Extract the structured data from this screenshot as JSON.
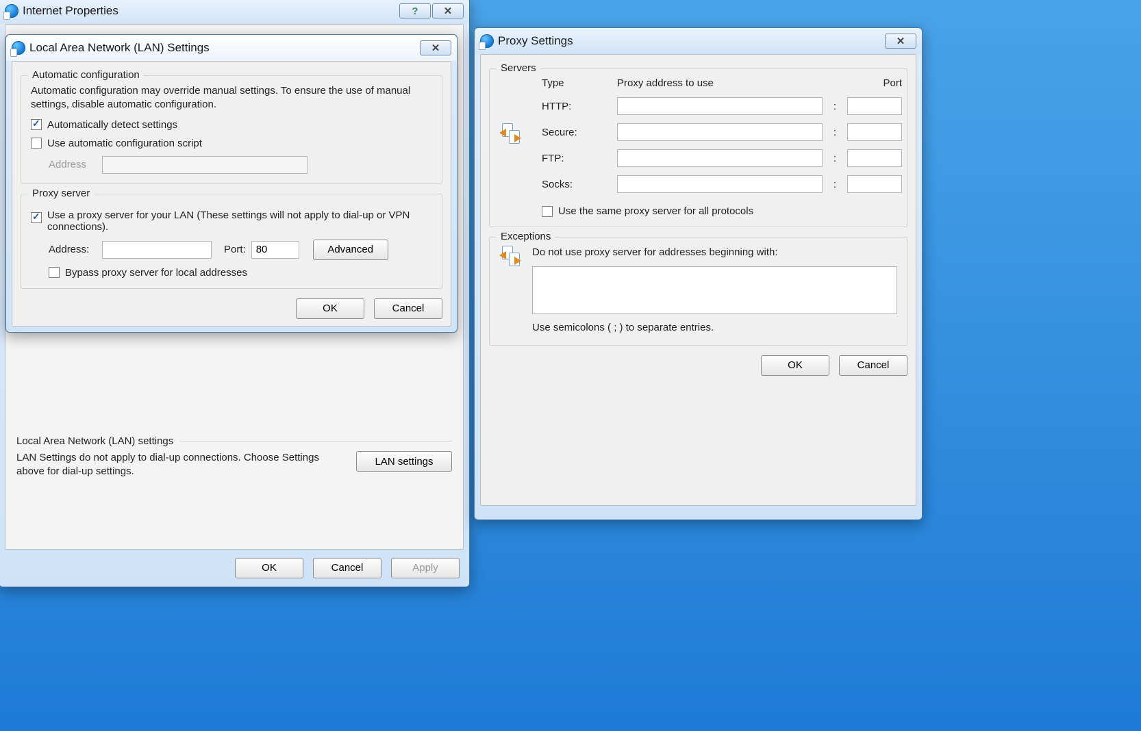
{
  "internet_properties": {
    "title": "Internet Properties",
    "lan_section": {
      "legend": "Local Area Network (LAN) settings",
      "note": "LAN Settings do not apply to dial-up connections.  Choose Settings above for dial-up settings.",
      "lan_button": "LAN settings"
    },
    "buttons": {
      "ok": "OK",
      "cancel": "Cancel",
      "apply": "Apply"
    }
  },
  "lan_settings": {
    "title": "Local Area Network (LAN) Settings",
    "auto": {
      "legend": "Automatic configuration",
      "note": "Automatic configuration may override manual settings.  To ensure the use of manual settings, disable automatic configuration.",
      "auto_detect": "Automatically detect settings",
      "use_script": "Use automatic configuration script",
      "address_label": "Address",
      "address_value": ""
    },
    "proxy": {
      "legend": "Proxy server",
      "use_proxy": "Use a proxy server for your LAN (These settings will not apply to dial-up or VPN connections).",
      "address_label": "Address:",
      "address_value": "",
      "port_label": "Port:",
      "port_value": "80",
      "advanced": "Advanced",
      "bypass_local": "Bypass proxy server for local addresses"
    },
    "buttons": {
      "ok": "OK",
      "cancel": "Cancel"
    }
  },
  "proxy_settings": {
    "title": "Proxy Settings",
    "servers": {
      "legend": "Servers",
      "col_type": "Type",
      "col_addr": "Proxy address to use",
      "col_port": "Port",
      "rows": {
        "http": {
          "label": "HTTP:",
          "addr": "",
          "port": ""
        },
        "secure": {
          "label": "Secure:",
          "addr": "",
          "port": ""
        },
        "ftp": {
          "label": "FTP:",
          "addr": "",
          "port": ""
        },
        "socks": {
          "label": "Socks:",
          "addr": "",
          "port": ""
        }
      },
      "same_for_all": "Use the same proxy server for all protocols"
    },
    "exceptions": {
      "legend": "Exceptions",
      "note": "Do not use proxy server for addresses beginning with:",
      "value": "",
      "hint": "Use semicolons ( ; ) to separate entries."
    },
    "buttons": {
      "ok": "OK",
      "cancel": "Cancel"
    }
  }
}
